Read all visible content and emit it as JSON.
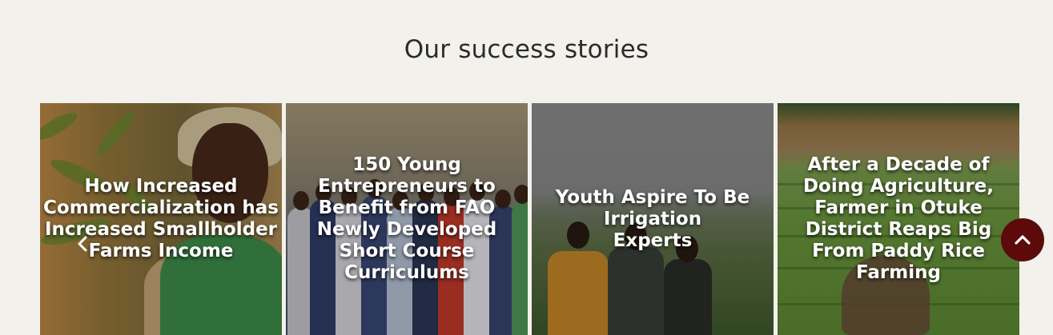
{
  "section": {
    "title": "Our success stories"
  },
  "cards": [
    {
      "title": "How Increased\nCommercialization has\nIncreased Smallholder\nFarms Income"
    },
    {
      "title": "150 Young\nEntrepreneurs to\nBenefit from FAO\nNewly Developed\nShort Course\nCurriculums"
    },
    {
      "title": "Youth Aspire To Be Irrigation\nExperts"
    },
    {
      "title": "After a Decade of\nDoing Agriculture,\nFarmer in Otuke\nDistrict Reaps Big\nFrom Paddy Rice\nFarming"
    }
  ],
  "controls": {
    "prev_icon": "chevron-left-icon",
    "scroll_top_icon": "chevron-up-icon",
    "scroll_top_color": "#5c0a0a"
  }
}
